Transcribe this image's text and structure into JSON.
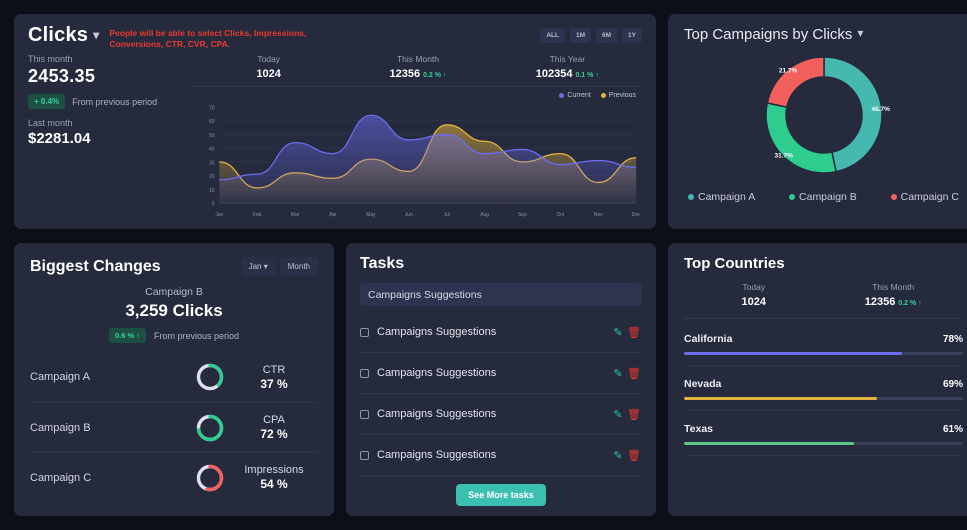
{
  "clicks_card": {
    "title": "Clicks",
    "chevron_icon": "chevron-down-icon",
    "warning_note": "People will be able to select Clicks, Impressions, Conversions, CTR, CVR, CPA.",
    "range_buttons": [
      "ALL",
      "1M",
      "6M",
      "1Y"
    ],
    "this_month_label": "This month",
    "this_month_value": "2453.35",
    "change_badge": "+ 0.4%",
    "change_text": "From previous period",
    "last_month_label": "Last month",
    "last_month_value": "$2281.04",
    "kpis": [
      {
        "label": "Today",
        "value": "1024",
        "delta": "",
        "arrow": ""
      },
      {
        "label": "This Month",
        "value": "12356",
        "delta": "0.2 %",
        "arrow": "↑"
      },
      {
        "label": "This Year",
        "value": "102354",
        "delta": "0.1 %",
        "arrow": "↑"
      }
    ],
    "legend": [
      {
        "name": "Current",
        "color": "#6c6cf0"
      },
      {
        "name": "Previous",
        "color": "#e5b43c"
      }
    ]
  },
  "chart_data": [
    {
      "type": "area",
      "title": "Clicks",
      "xlabel": "",
      "ylabel": "",
      "categories": [
        "Jan",
        "Feb",
        "Mar",
        "Apr",
        "May",
        "Jun",
        "Jul",
        "Aug",
        "Sep",
        "Oct",
        "Nov",
        "Dec"
      ],
      "yticks": [
        0,
        10,
        20,
        30,
        40,
        50,
        60,
        70
      ],
      "ylim": [
        0,
        70
      ],
      "grid": true,
      "legend_position": "top-right",
      "series": [
        {
          "name": "Current",
          "color": "#6c6cf0",
          "values": [
            17,
            21,
            44,
            36,
            64,
            46,
            50,
            36,
            39,
            28,
            31,
            26
          ]
        },
        {
          "name": "Previous",
          "color": "#e5b43c",
          "values": [
            30,
            11,
            22,
            18,
            32,
            23,
            57,
            45,
            30,
            36,
            15,
            33
          ]
        }
      ]
    },
    {
      "type": "pie",
      "title": "Top Campaigns by Clicks",
      "labels": [
        "Campaign A",
        "Campaign B",
        "Campaign C"
      ],
      "values": [
        46.7,
        31.7,
        21.7
      ],
      "value_labels": [
        "46.7%",
        "31.7%",
        "21.7%"
      ],
      "colors": [
        "#45b8b0",
        "#2ecc8f",
        "#f25f5c"
      ],
      "legend_position": "bottom"
    }
  ],
  "donut_card": {
    "title": "Top Campaigns by Clicks",
    "chevron_icon": "chevron-down-icon"
  },
  "biggest_changes": {
    "title": "Biggest Changes",
    "month_select": "Jan",
    "month_select_icon": "chevron-down-icon",
    "period_button": "Month",
    "campaign": "Campaign B",
    "clicks": "3,259 Clicks",
    "badge": "0.6 % ↑",
    "badge_text": "From previous period",
    "rows": [
      {
        "name": "Campaign A",
        "metric": "CTR",
        "value": "37 %",
        "pct": 37,
        "color": "#2ecc8f"
      },
      {
        "name": "Campaign B",
        "metric": "CPA",
        "value": "72 %",
        "pct": 72,
        "color": "#2ecc8f"
      },
      {
        "name": "Campaign C",
        "metric": "Impressions",
        "value": "54 %",
        "pct": 54,
        "color": "#f25f5c"
      }
    ]
  },
  "tasks": {
    "title": "Tasks",
    "input_value": "Campaigns Suggestions",
    "input_placeholder": "Campaigns Suggestions",
    "items": [
      {
        "label": "Campaigns Suggestions",
        "edit_icon": "pencil-icon",
        "delete_icon": "trash-icon"
      },
      {
        "label": "Campaigns Suggestions",
        "edit_icon": "pencil-icon",
        "delete_icon": "trash-icon"
      },
      {
        "label": "Campaigns Suggestions",
        "edit_icon": "pencil-icon",
        "delete_icon": "trash-icon"
      },
      {
        "label": "Campaigns Suggestions",
        "edit_icon": "pencil-icon",
        "delete_icon": "trash-icon"
      }
    ],
    "see_more_label": "See More tasks"
  },
  "top_countries": {
    "title": "Top Countries",
    "kpis": [
      {
        "label": "Today",
        "value": "1024",
        "delta": "",
        "arrow": ""
      },
      {
        "label": "This Month",
        "value": "12356",
        "delta": "0.2 %",
        "arrow": "↑"
      }
    ],
    "rows": [
      {
        "name": "California",
        "pct_label": "78%",
        "pct": 78,
        "color": "#6c6cf0"
      },
      {
        "name": "Nevada",
        "pct_label": "69%",
        "pct": 69,
        "color": "#e5b43c"
      },
      {
        "name": "Texas",
        "pct_label": "61%",
        "pct": 61,
        "color": "#5cc98c"
      }
    ]
  }
}
